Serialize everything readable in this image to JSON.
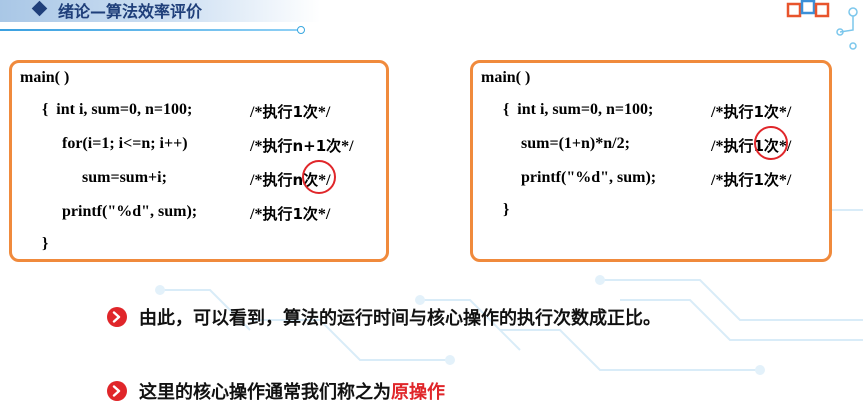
{
  "header": {
    "title_main": "绪论",
    "title_sep": "—",
    "title_sub": "算法效率评价"
  },
  "left_code": {
    "lines": [
      {
        "code": "main( )",
        "comment": ""
      },
      {
        "code": "{  int i, sum=0, n=100;",
        "comment_pre": "/*",
        "comment_zh": "执行1次",
        "comment_post": "*/"
      },
      {
        "code": "for(i=1; i<=n; i++)",
        "comment_pre": "/*",
        "comment_zh": "执行n+1次",
        "comment_post": "*/"
      },
      {
        "code": "sum=sum+i;",
        "comment_pre": "/*",
        "comment_zh": "执行n次",
        "comment_post": "*/"
      },
      {
        "code": "printf(\"%d\", sum);",
        "comment_pre": "/*",
        "comment_zh": "执行1次",
        "comment_post": "*/"
      },
      {
        "code": "}",
        "comment": ""
      }
    ]
  },
  "right_code": {
    "lines": [
      {
        "code": "main( )",
        "comment": ""
      },
      {
        "code": "{  int i, sum=0, n=100;",
        "comment_pre": "/*",
        "comment_zh": "执行1次",
        "comment_post": "*/"
      },
      {
        "code": "sum=(1+n)*n/2;",
        "comment_pre": "/*",
        "comment_zh": "执行1次",
        "comment_post": "*/"
      },
      {
        "code": "printf(\"%d\", sum);",
        "comment_pre": "/*",
        "comment_zh": "执行1次",
        "comment_post": "*/"
      },
      {
        "code": "}",
        "comment": ""
      }
    ]
  },
  "bullets": {
    "first": "由此，可以看到，算法的运行时间与核心操作的执行次数成正比。",
    "second_prefix": "这里的核心操作通常我们称之为",
    "second_highlight": "原操作"
  },
  "colors": {
    "box_border": "#f08a3c",
    "highlight_red": "#e0262a",
    "title_blue": "#1f3f7a"
  }
}
